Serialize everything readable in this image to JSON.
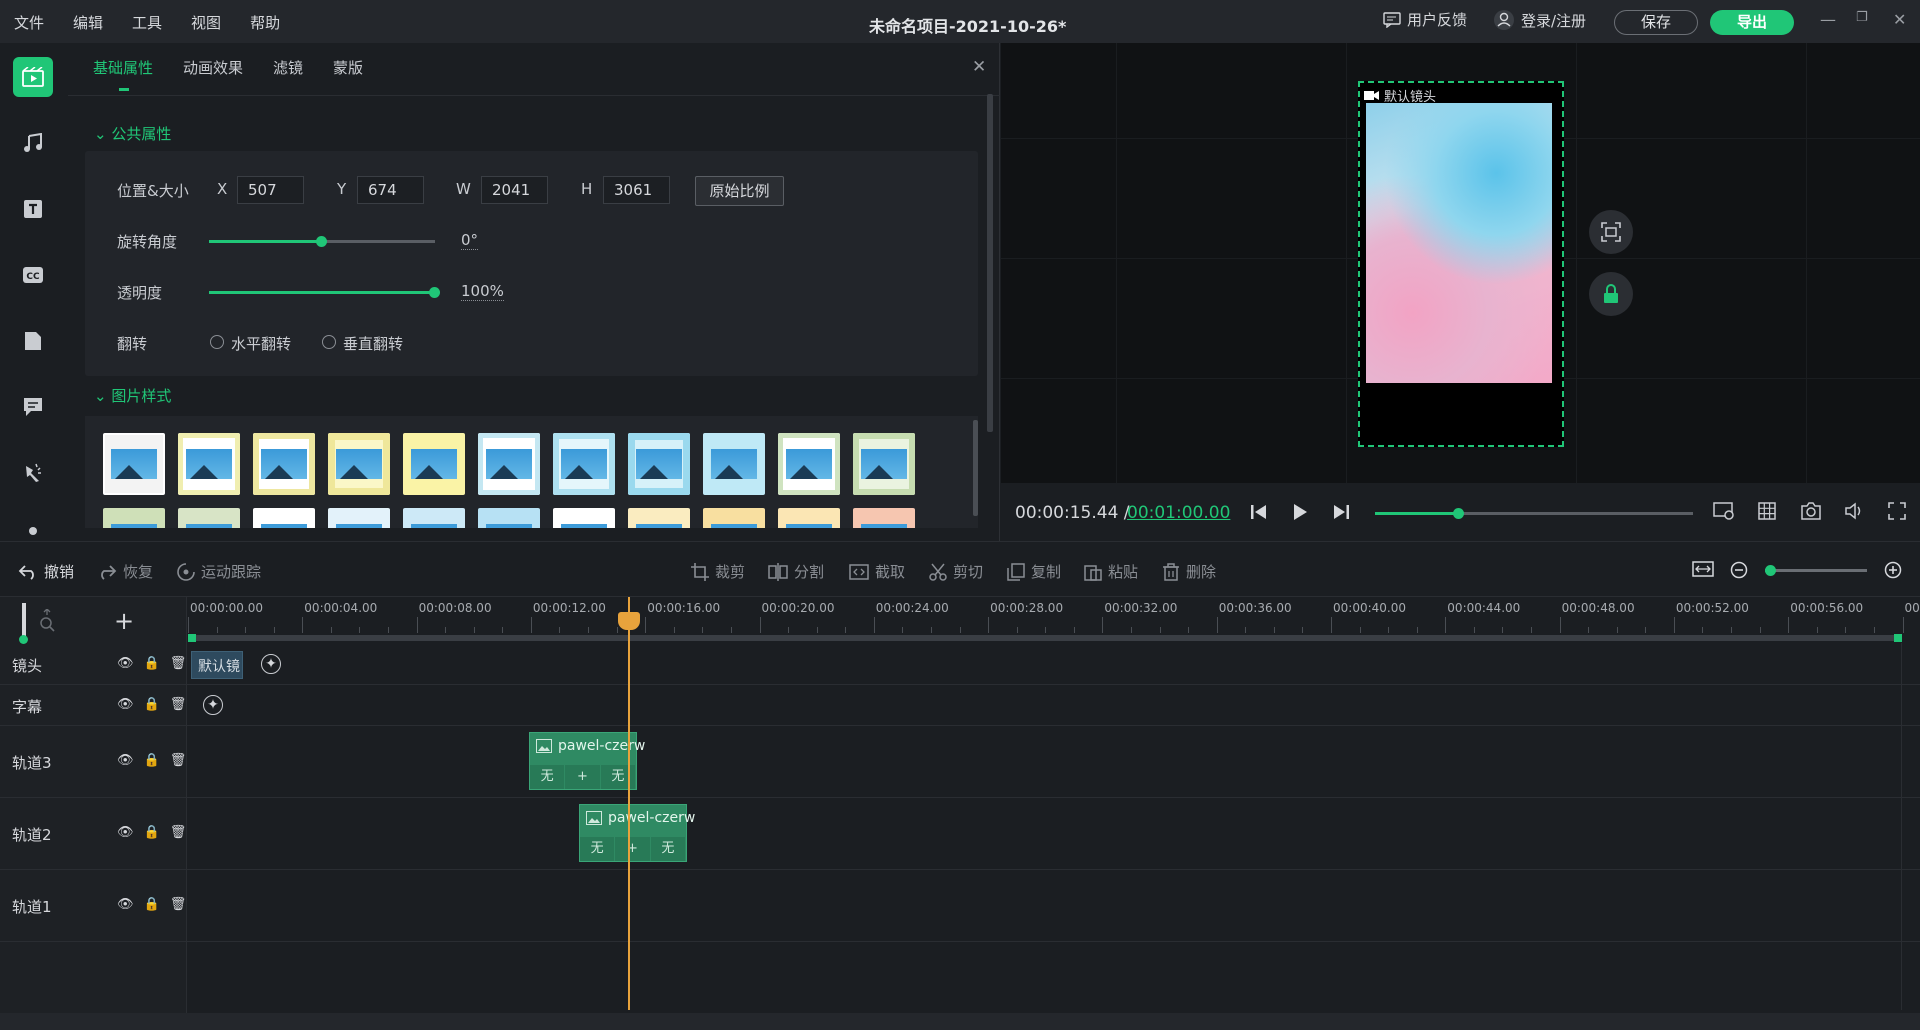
{
  "menu": [
    "文件",
    "编辑",
    "工具",
    "视图",
    "帮助"
  ],
  "title": "未命名项目-2021-10-26*",
  "top_right": {
    "feedback": "用户反馈",
    "login": "登录/注册",
    "save": "保存",
    "export": "导出"
  },
  "props": {
    "tabs": [
      "基础属性",
      "动画效果",
      "滤镜",
      "蒙版"
    ],
    "section_common": "公共属性",
    "pos_size_label": "位置&大小",
    "x_label": "X",
    "x": "507",
    "y_label": "Y",
    "y": "674",
    "w_label": "W",
    "w": "2041",
    "h_label": "H",
    "h": "3061",
    "ratio_btn": "原始比例",
    "rotation_label": "旋转角度",
    "rotation": "0°",
    "rotation_fraction": 0.5,
    "opacity_label": "透明度",
    "opacity": "100%",
    "opacity_fraction": 1.0,
    "flip_label": "翻转",
    "flip_h": "水平翻转",
    "flip_v": "垂直翻转",
    "section_style": "图片样式"
  },
  "preview": {
    "camera_label": "默认镜头"
  },
  "playback": {
    "current": "00:00:15.44 /",
    "total": "00:01:00.00",
    "progress_fraction": 0.26
  },
  "toolbar": {
    "undo": "撤销",
    "redo": "恢复",
    "motion": "运动跟踪",
    "crop": "裁剪",
    "split": "分割",
    "trim": "截取",
    "cut": "剪切",
    "copy": "复制",
    "paste": "粘贴",
    "delete": "删除"
  },
  "ruler": [
    "00:00:00.00",
    "00:00:04.00",
    "00:00:08.00",
    "00:00:12.00",
    "00:00:16.00",
    "00:00:20.00",
    "00:00:24.00",
    "00:00:28.00",
    "00:00:32.00",
    "00:00:36.00",
    "00:00:40.00",
    "00:00:44.00",
    "00:00:48.00",
    "00:00:52.00",
    "00:00:56.00",
    "00"
  ],
  "tracks": {
    "camera": "镜头",
    "subtitle": "字幕",
    "t3": "轨道3",
    "t2": "轨道2",
    "t1": "轨道1"
  },
  "clips": {
    "camera_clip": "默认镜",
    "clip3": "pawel-czerw",
    "clip2": "pawel-czerw",
    "none": "无",
    "plus": "+"
  },
  "colors": {
    "accent": "#20c677",
    "playhead": "#e8a33c"
  }
}
